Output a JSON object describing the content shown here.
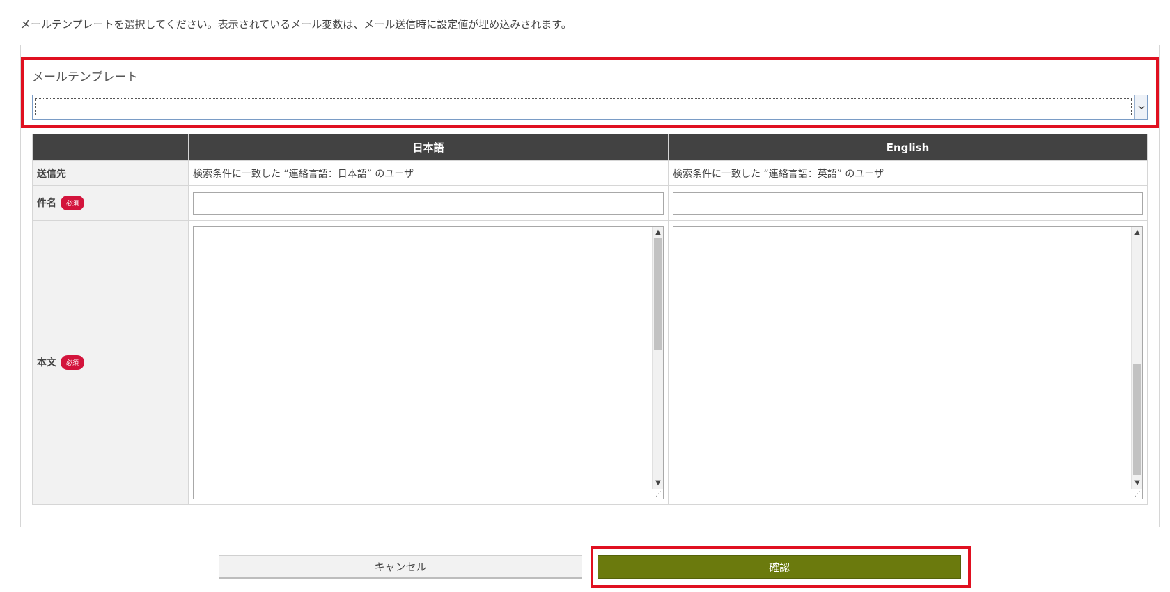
{
  "intro": "メールテンプレートを選択してください。表示されているメール変数は、メール送信時に設定値が埋め込みされます。",
  "template": {
    "label": "メールテンプレート",
    "selected_value": ""
  },
  "table": {
    "headers": [
      "",
      "日本語",
      "English"
    ],
    "rows": {
      "destination": {
        "label": "送信先",
        "ja": "検索条件に一致した “連絡言語：日本語” のユーザ",
        "en": "検索条件に一致した “連絡言語：英語” のユーザ"
      },
      "subject": {
        "label": "件名",
        "required_badge": "必須",
        "ja_value": "",
        "en_value": ""
      },
      "body": {
        "label": "本文",
        "required_badge": "必須",
        "ja_value": "",
        "en_value": ""
      }
    }
  },
  "buttons": {
    "cancel": "キャンセル",
    "confirm": "確認"
  },
  "colors": {
    "highlight": "#e01020",
    "header_bg": "#424242",
    "required_badge": "#d3143c",
    "confirm_button": "#6b7a0d"
  },
  "icons": {
    "select_arrow": "chevron-down-icon",
    "scroll_up": "arrow-up-icon",
    "scroll_down": "arrow-down-icon"
  }
}
